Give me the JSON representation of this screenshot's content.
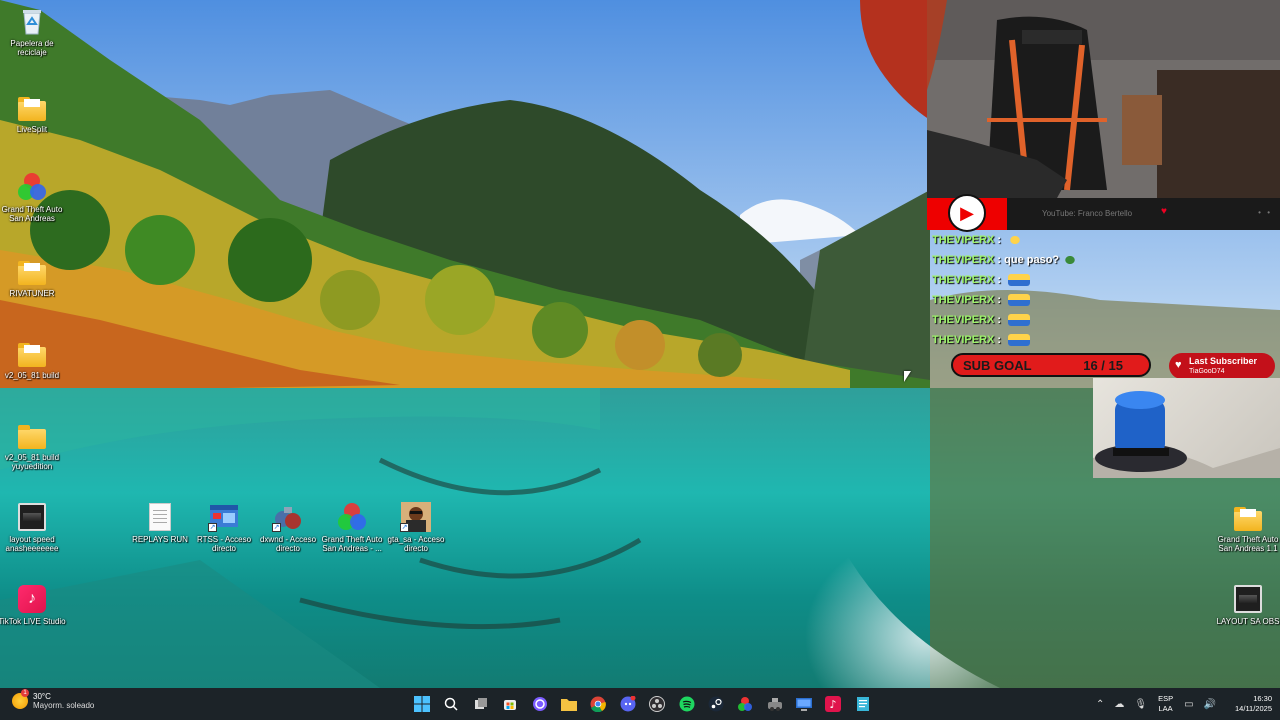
{
  "desktop": {
    "icons_left": [
      {
        "label": "Papelera de reciclaje",
        "icon": "recycle-bin-icon"
      },
      {
        "label": "LiveSplit",
        "icon": "folder-icon"
      },
      {
        "label": "Grand Theft Auto San Andreas",
        "icon": "rgb-app-icon"
      },
      {
        "label": "RIVATUNER",
        "icon": "folder-icon"
      },
      {
        "label": "v2_05_81 build",
        "icon": "folder-icon"
      },
      {
        "label": "v2_05_81 build yuyuedition",
        "icon": "folder-icon"
      },
      {
        "label": "layout speed anasheeeeeee",
        "icon": "window-icon"
      },
      {
        "label": "TikTok LIVE Studio",
        "icon": "tiktok-icon"
      }
    ],
    "icons_row": [
      {
        "label": "REPLAYS RUN",
        "icon": "text-file-icon"
      },
      {
        "label": "RTSS - Acceso directo",
        "icon": "rtss-icon"
      },
      {
        "label": "dxwnd - Acceso directo",
        "icon": "dxwnd-icon"
      },
      {
        "label": "Grand Theft Auto San Andreas - ...",
        "icon": "rgb-app-icon"
      },
      {
        "label": "gta_sa - Acceso directo",
        "icon": "gta-icon"
      }
    ],
    "icons_right": [
      {
        "label": "Grand Theft Auto San Andreas 1.1",
        "icon": "folder-icon"
      },
      {
        "label": "LAYOUT SA OBS",
        "icon": "window-icon"
      }
    ]
  },
  "overlay": {
    "youtube_text": "YouTube: Franco Bertello",
    "chat": [
      {
        "user": "THEVIPERX",
        "message": "",
        "emote": "emote-face"
      },
      {
        "user": "THEVIPERX",
        "message": "que paso?",
        "emote": "emote-green"
      },
      {
        "user": "THEVIPERX",
        "message": "",
        "emote": "emote-car"
      },
      {
        "user": "THEVIPERX",
        "message": "",
        "emote": "emote-car"
      },
      {
        "user": "THEVIPERX",
        "message": "",
        "emote": "emote-car"
      },
      {
        "user": "THEVIPERX",
        "message": "",
        "emote": "emote-car"
      }
    ],
    "sub_goal": {
      "label": "SUB GOAL",
      "value": "16 / 15"
    },
    "last_subscriber": {
      "title": "Last Subscriber",
      "name": "TiaGooD74"
    }
  },
  "taskbar": {
    "weather": {
      "temp": "30°C",
      "condition": "Mayorm. soleado",
      "badge": "1"
    },
    "apps": [
      "windows-start-icon",
      "search-icon",
      "task-view-icon",
      "store-icon",
      "obs-icon",
      "file-explorer-icon",
      "chrome-icon",
      "discord-icon",
      "obs-studio-icon",
      "spotify-icon",
      "steam-icon",
      "rgb-app-icon",
      "rtss-icon",
      "remote-desktop-icon",
      "tiktok-icon",
      "notepad-icon"
    ],
    "tray": {
      "lang_line1": "ESP",
      "lang_line2": "LAA",
      "time": "16:30",
      "date": "14/11/2025"
    }
  },
  "colors": {
    "chat_user": "#9cf26a",
    "overlay_red": "#e11b1b",
    "taskbar": "#1c2328"
  }
}
